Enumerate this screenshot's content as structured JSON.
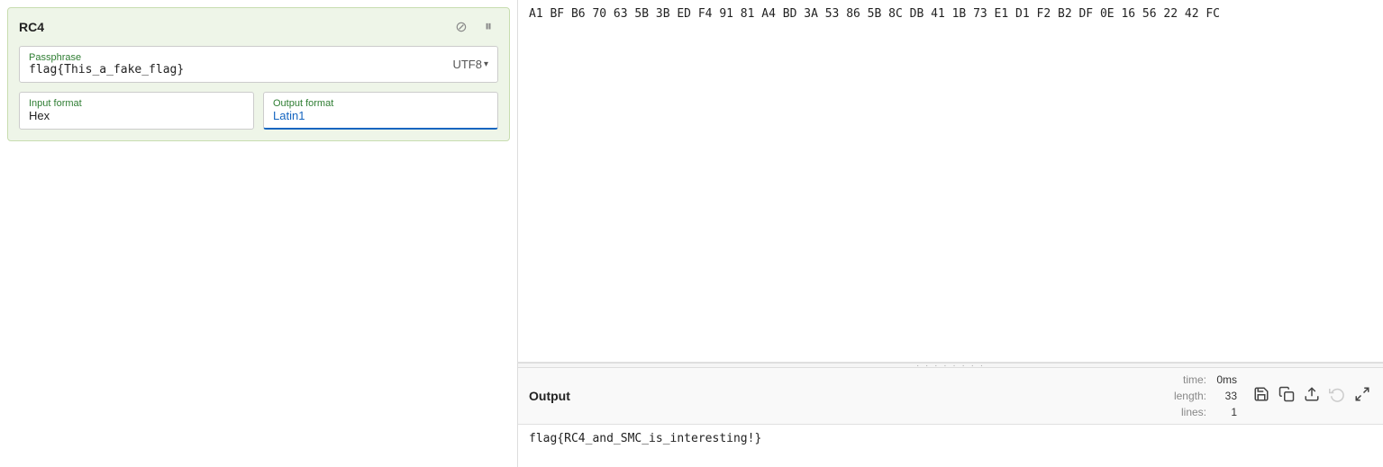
{
  "left": {
    "rc4_title": "RC4",
    "passphrase_label": "Passphrase",
    "passphrase_value": "flag{This_a_fake_flag}",
    "encoding_label": "UTF8",
    "encoding_arrow": "▾",
    "input_format_label": "Input format",
    "input_format_value": "Hex",
    "output_format_label": "Output format",
    "output_format_value": "Latin1"
  },
  "hex_data": "A1 BF B6 70 63 5B 3B ED F4 91 81 A4 BD 3A 53 86 5B 8C DB 41 1B 73 E1 D1 F2 B2 DF 0E 16 56 22 42 FC",
  "output": {
    "label": "Output",
    "time_key": "time:",
    "time_val": "0ms",
    "length_key": "length:",
    "length_val": "33",
    "lines_key": "lines:",
    "lines_val": "1",
    "content": "flag{RC4_and_SMC_is_interesting!}"
  },
  "icons": {
    "disable": "⊘",
    "pause": "⏸",
    "save": "💾",
    "copy": "📋",
    "upload": "⬆",
    "undo": "↩",
    "expand": "⛶"
  }
}
